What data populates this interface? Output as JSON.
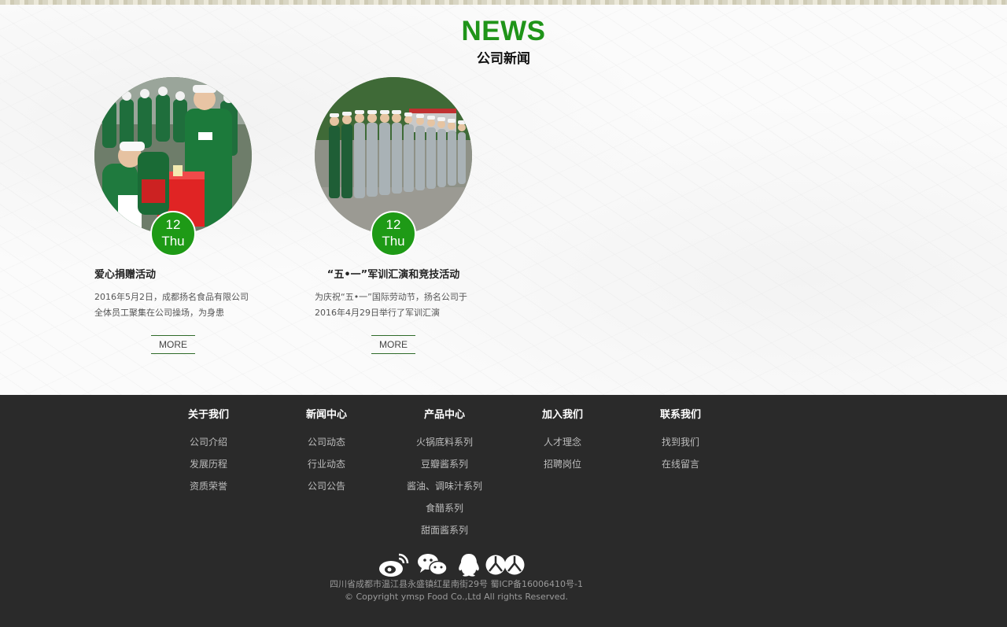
{
  "header": {
    "title": "NEWS",
    "subtitle": "公司新闻"
  },
  "news": [
    {
      "day": "12",
      "weekday": "Thu",
      "title": "爱心捐赠活动",
      "excerpt": "2016年5月2日，成都扬名食品有限公司全体员工聚集在公司操场，为身患",
      "more_label": "MORE",
      "photo_icon": "donation-photo"
    },
    {
      "day": "12",
      "weekday": "Thu",
      "title": "“五•一”军训汇演和竞技活动",
      "excerpt": "为庆祝“五•一”国际劳动节，扬名公司于2016年4月29日举行了军训汇演",
      "more_label": "MORE",
      "photo_icon": "military-training-photo"
    }
  ],
  "footer": {
    "columns": [
      {
        "heading": "关于我们",
        "links": [
          "公司介绍",
          "发展历程",
          "资质荣誉"
        ]
      },
      {
        "heading": "新闻中心",
        "links": [
          "公司动态",
          "行业动态",
          "公司公告"
        ]
      },
      {
        "heading": "产品中心",
        "links": [
          "火锅底料系列",
          "豆瓣酱系列",
          "酱油、调味汁系列",
          "食醋系列",
          "甜面酱系列"
        ]
      },
      {
        "heading": "加入我们",
        "links": [
          "人才理念",
          "招聘岗位"
        ]
      },
      {
        "heading": "联系我们",
        "links": [
          "找到我们",
          "在线留言"
        ]
      }
    ],
    "social_icons": [
      "weibo-icon",
      "wechat-icon",
      "qq-icon",
      "renren-icon"
    ],
    "address": "四川省成都市温江县永盛镇红星南街29号 蜀ICP备16006410号-1",
    "copyright": "© Copyright ymsp Food Co.,Ltd All rights Reserved."
  },
  "colors": {
    "accent": "#1e9a16",
    "footer_bg": "#2a2a2a",
    "footer_text": "#bdbdbd"
  }
}
